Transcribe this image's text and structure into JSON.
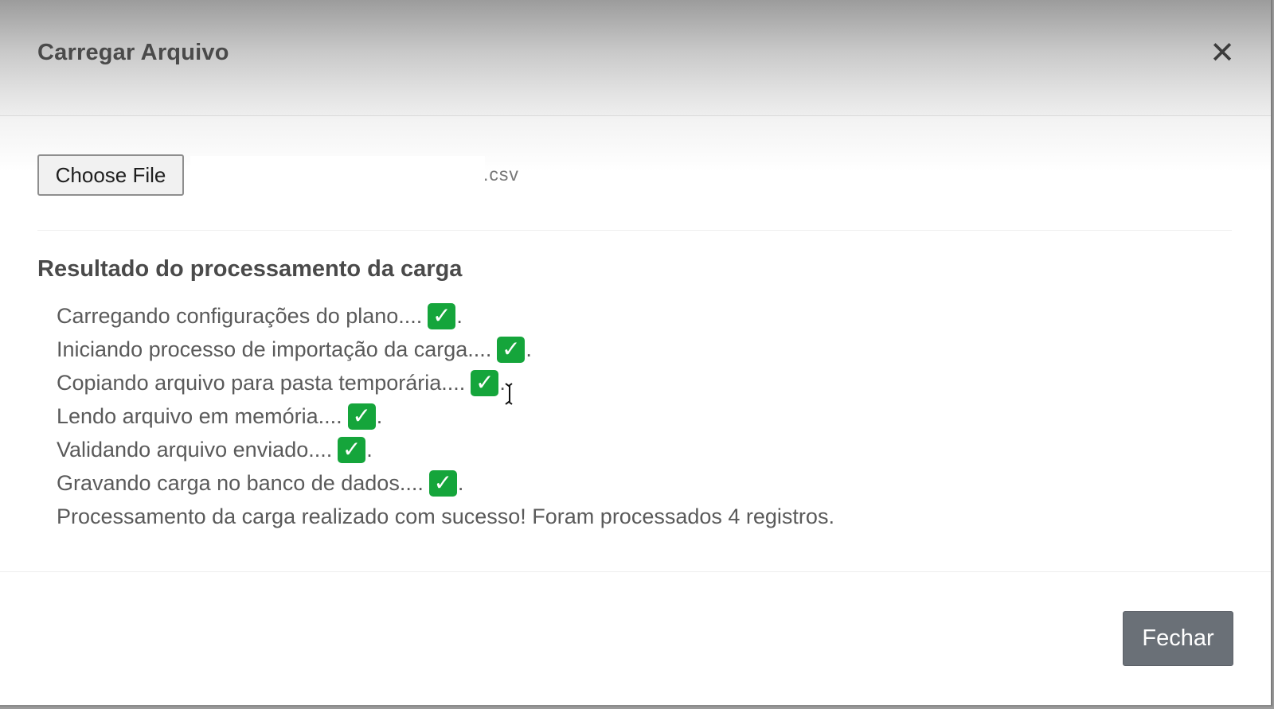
{
  "modal": {
    "title": "Carregar Arquivo",
    "close_glyph": "✕"
  },
  "file_input": {
    "button_label": "Choose File",
    "file_name_visible": ".csv"
  },
  "result": {
    "title": "Resultado do processamento da carga",
    "steps": [
      {
        "text": "Carregando configurações do plano....",
        "status": "done"
      },
      {
        "text": "Iniciando processo de importação da carga....",
        "status": "done"
      },
      {
        "text": "Copiando arquivo para pasta temporária....",
        "status": "done"
      },
      {
        "text": "Lendo arquivo em memória....",
        "status": "done"
      },
      {
        "text": "Validando arquivo enviado....",
        "status": "done"
      },
      {
        "text": "Gravando carga no banco de dados....",
        "status": "done"
      }
    ],
    "check_glyph": "✓",
    "summary": "Processamento da carga realizado com sucesso! Foram processados 4 registros."
  },
  "footer": {
    "close_button_label": "Fechar"
  },
  "colors": {
    "check_green": "#15a53b",
    "fechar_bg": "#6a7077",
    "title_text": "#4a4a4a"
  },
  "icons": {
    "close": "close-icon",
    "check": "checkmark-icon",
    "cursor": "text-cursor-icon"
  }
}
